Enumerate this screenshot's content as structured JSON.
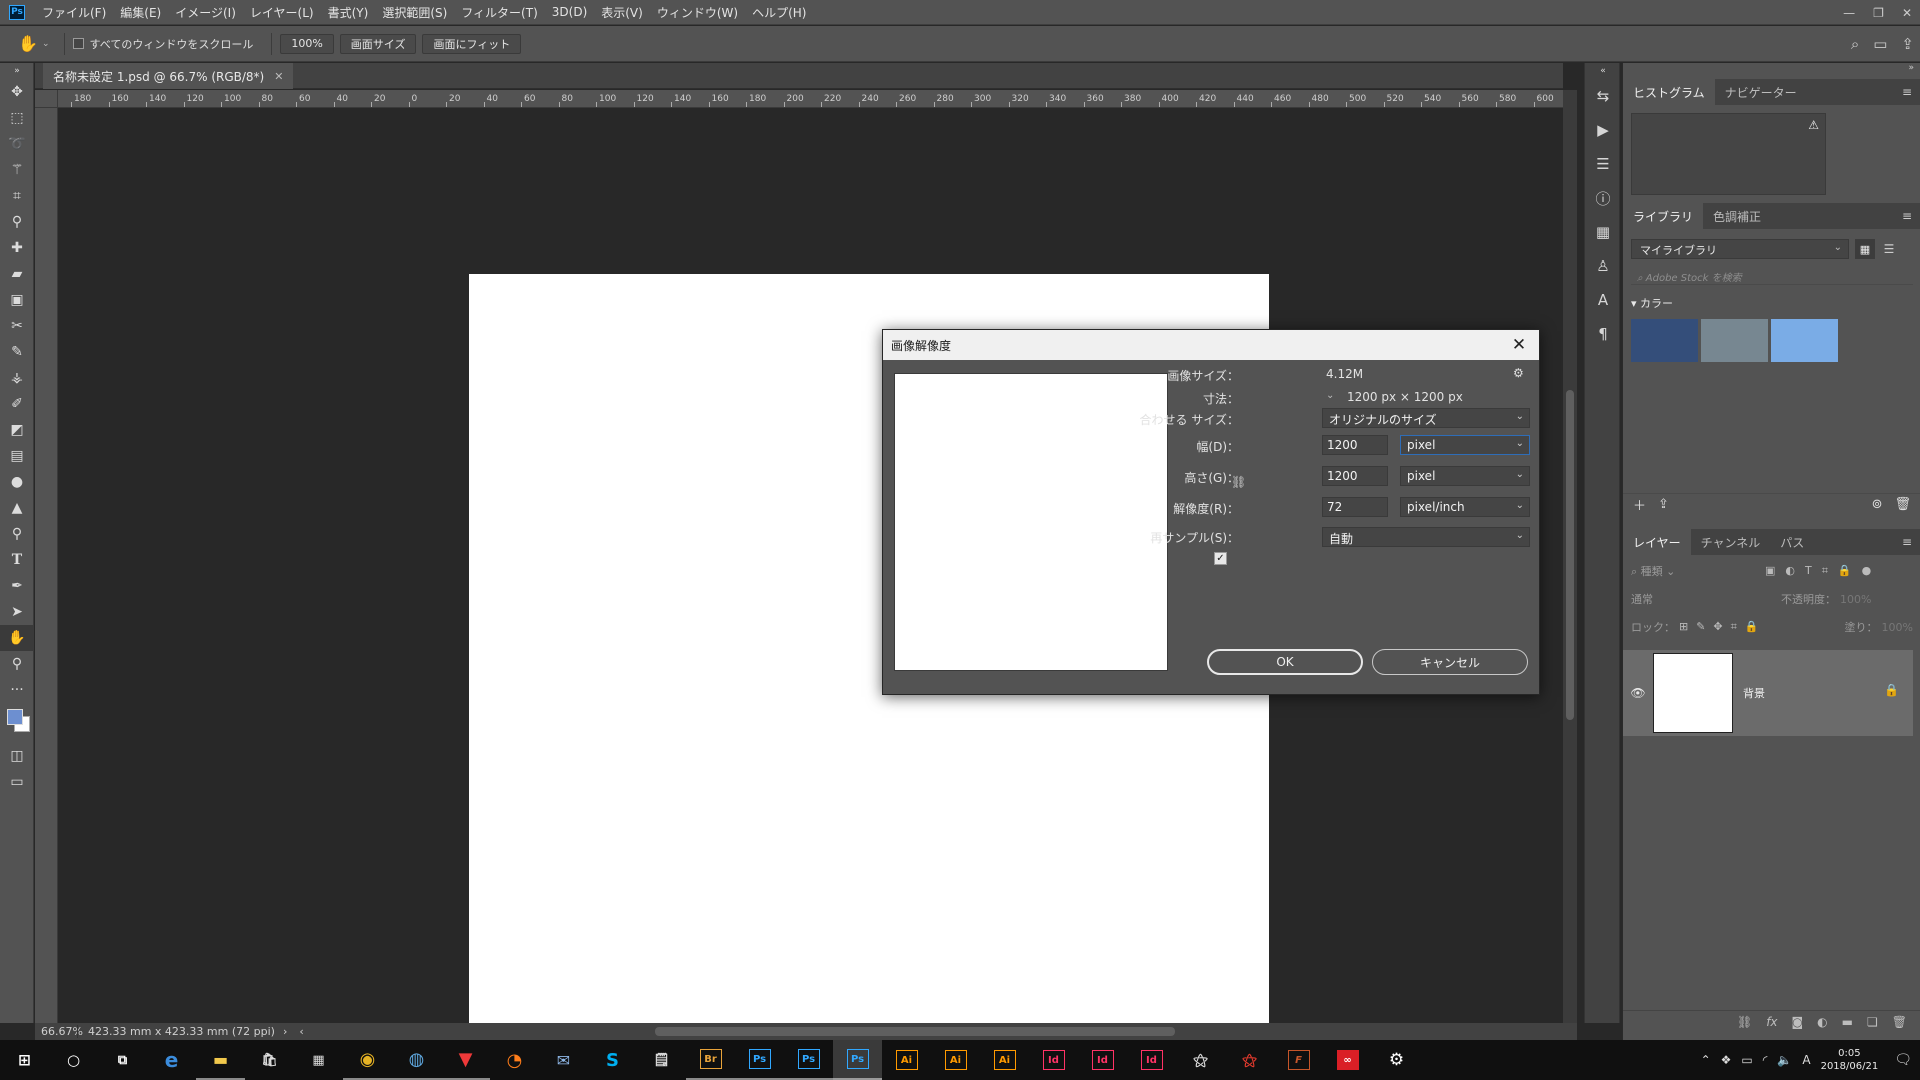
{
  "menu": {
    "logo": "Ps",
    "items": [
      "ファイル(F)",
      "編集(E)",
      "イメージ(I)",
      "レイヤー(L)",
      "書式(Y)",
      "選択範囲(S)",
      "フィルター(T)",
      "3D(D)",
      "表示(V)",
      "ウィンドウ(W)",
      "ヘルプ(H)"
    ]
  },
  "options": {
    "scroll_all_label": "すべてのウィンドウをスクロール",
    "zoom_btn": "100%",
    "screen_size_btn": "画面サイズ",
    "fit_screen_btn": "画面にフィット"
  },
  "document": {
    "tab_title": "名称未設定 1.psd @ 66.7% (RGB/8*)"
  },
  "ruler": {
    "ticks": [
      "180",
      "160",
      "140",
      "120",
      "100",
      "80",
      "60",
      "40",
      "20",
      "0",
      "20",
      "40",
      "60",
      "80",
      "100",
      "120",
      "140",
      "160",
      "180",
      "200",
      "220",
      "240",
      "260",
      "280",
      "300",
      "320",
      "340",
      "360",
      "380",
      "400",
      "420",
      "440",
      "460",
      "480",
      "500",
      "520",
      "540",
      "560",
      "580",
      "600"
    ]
  },
  "status": {
    "zoom": "66.67%",
    "info": "423.33 mm x 423.33 mm (72 ppi)"
  },
  "panels": {
    "top_tabs": [
      "ヒストグラム",
      "ナビゲーター"
    ],
    "library_tabs": [
      "ライブラリ",
      "色調補正"
    ],
    "library_select": "マイライブラリ",
    "library_search_placeholder": "Adobe Stock を検索",
    "color_section": "カラー",
    "swatches": [
      "#344e7a",
      "#778791",
      "#7aace6"
    ],
    "layer_tabs": [
      "レイヤー",
      "チャンネル",
      "パス"
    ],
    "layer_filter": "種類",
    "blend_mode": "通常",
    "opacity_label": "不透明度：",
    "opacity_value": "100%",
    "lock_label": "ロック：",
    "fill_label": "塗り：",
    "fill_value": "100%",
    "layer_name": "背景"
  },
  "dialog": {
    "title": "画像解像度",
    "image_size_label": "画像サイズ：",
    "image_size_value": "4.12M",
    "dimensions_label": "寸法：",
    "dimensions_value": "1200 px × 1200 px",
    "fit_to_label": "合わせる サイズ：",
    "fit_to_value": "オリジナルのサイズ",
    "width_label": "幅(D)：",
    "width_value": "1200",
    "width_unit": "pixel",
    "height_label": "高さ(G)：",
    "height_value": "1200",
    "height_unit": "pixel",
    "resolution_label": "解像度(R)：",
    "resolution_value": "72",
    "resolution_unit": "pixel/inch",
    "resample_label": "再サンプル(S)：",
    "resample_checked": true,
    "resample_value": "自動",
    "ok_label": "OK",
    "cancel_label": "キャンセル"
  },
  "taskbar": {
    "apps": [
      {
        "name": "Br",
        "color": "#e8a33a"
      },
      {
        "name": "Ps",
        "color": "#31a8ff"
      },
      {
        "name": "Ps",
        "color": "#31a8ff"
      },
      {
        "name": "Ps",
        "color": "#31a8ff"
      },
      {
        "name": "Ai",
        "color": "#ff9a00"
      },
      {
        "name": "Ai",
        "color": "#ff9a00"
      },
      {
        "name": "Ai",
        "color": "#ff9a00"
      },
      {
        "name": "Id",
        "color": "#ff3366"
      },
      {
        "name": "Id",
        "color": "#ff3366"
      },
      {
        "name": "Id",
        "color": "#ff3366"
      }
    ],
    "ime": "A",
    "time": "0:05",
    "date": "2018/06/21"
  }
}
